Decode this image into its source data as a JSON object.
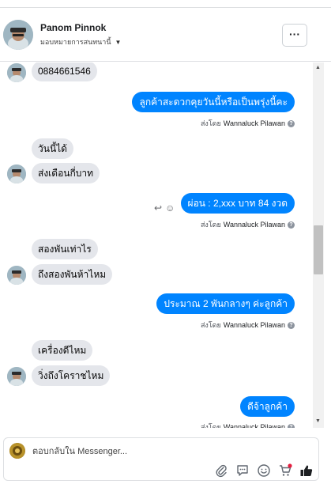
{
  "header": {
    "name": "Panom Pinnok",
    "assign_label": "มอบหมายการสนทนานี้",
    "more_label": "···"
  },
  "messages": {
    "m1": "0884661546",
    "m2": "ลูกค้าสะดวกคุยวันนี้หรือเป็นพรุ่งนี้คะ",
    "m3": "วันนี้ได้",
    "m4": "ส่งเดือนกี่บาท",
    "m5": "ผ่อน : 2,xxx บาท 84 งวด",
    "m6": "สองพันเท่าไร",
    "m7": "ถึงสองพันห้าไหม",
    "m8": "ประมาณ 2 พันกลางๆ ค่ะลูกค้า",
    "m9": "เครื่องดีไหม",
    "m10": "วิ่งถึงโคราชไหม",
    "m11": "ดีจ้าลูกค้า"
  },
  "sent_by": {
    "prefix": "ส่งโดย",
    "name": "Wannaluck Pilawan"
  },
  "composer": {
    "placeholder": "ตอบกลับใน Messenger..."
  },
  "colors": {
    "outgoing_bubble": "#0084ff",
    "incoming_bubble": "#e4e6eb",
    "like_icon": "#1c1e21",
    "notification_dot": "#e41e3f"
  },
  "icons": {
    "composer": [
      "paperclip-icon",
      "comment-icon",
      "emoji-icon",
      "cart-icon",
      "thumbs-up-icon"
    ],
    "message_actions": [
      "reply-icon",
      "emoji-react-icon"
    ]
  }
}
